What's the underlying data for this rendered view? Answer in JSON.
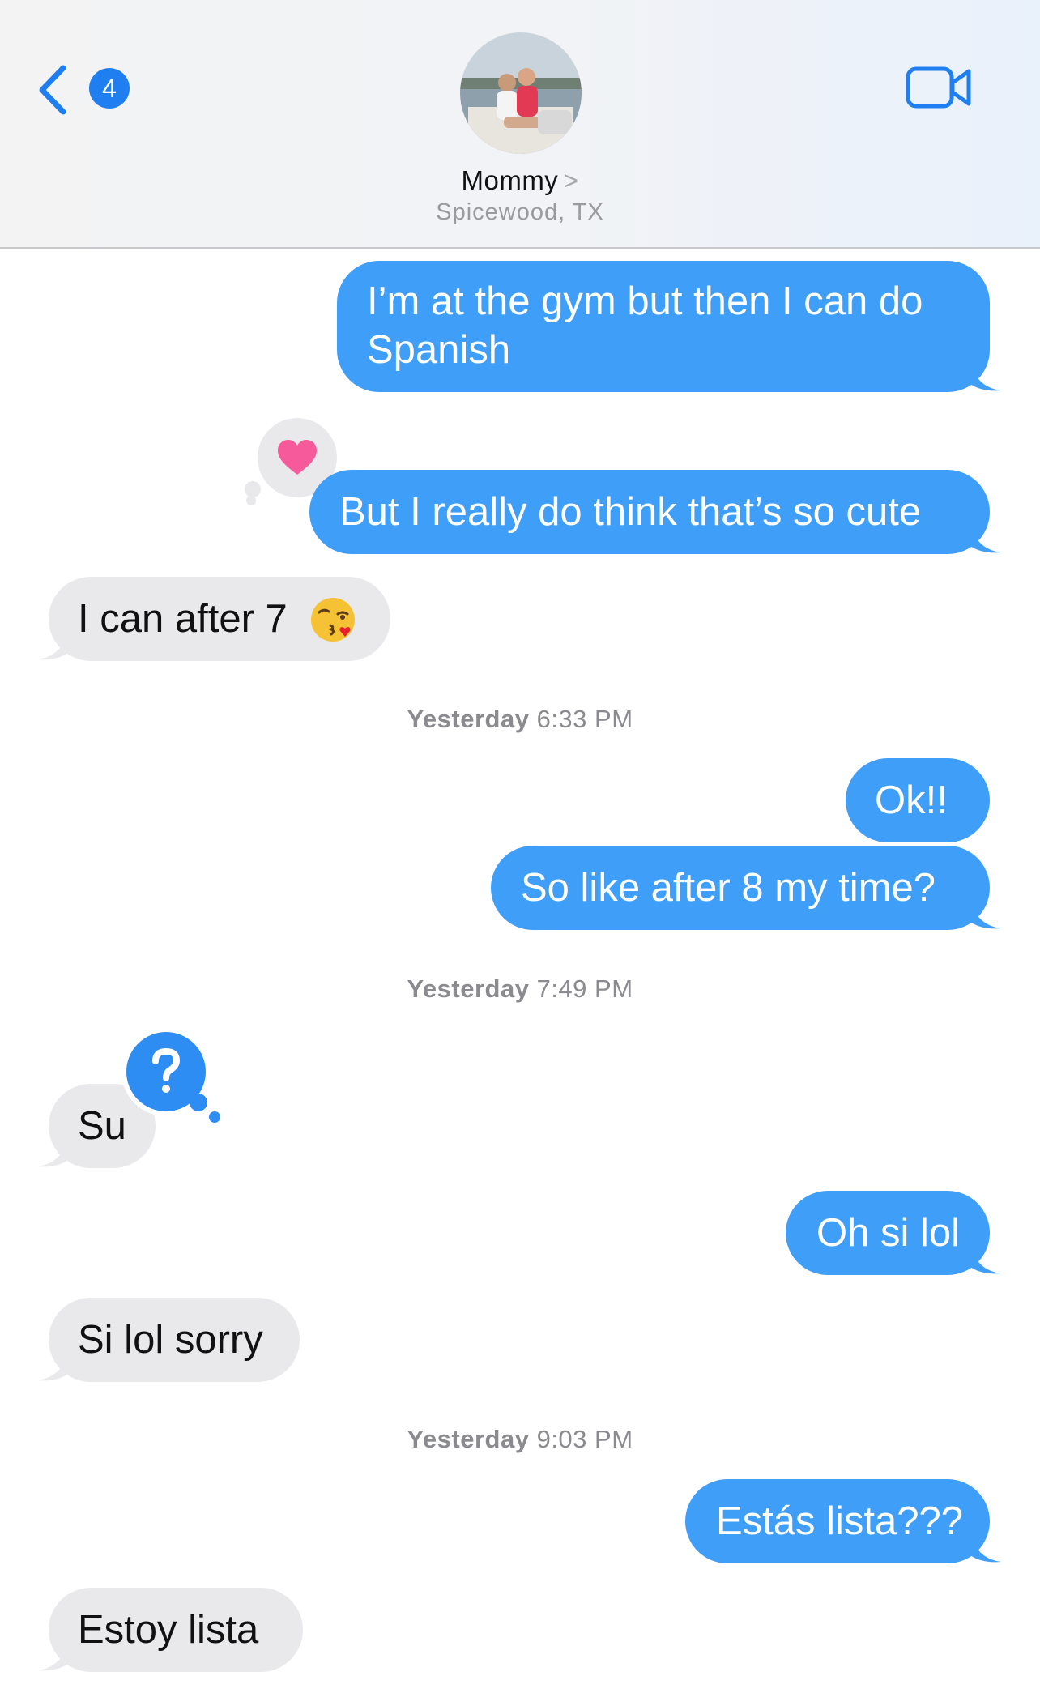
{
  "header": {
    "back_badge_count": "4",
    "contact_name": "Mommy",
    "contact_location": "Spicewood, TX",
    "chevron": ">"
  },
  "colors": {
    "accent": "#1f7ff0",
    "outgoing_bubble": "#3f9ff8",
    "incoming_bubble": "#e9e9eb",
    "heart": "#f75a9a"
  },
  "icons": {
    "back": "chevron-left-icon",
    "video": "video-camera-icon",
    "tapback_love": "heart-icon",
    "tapback_question": "question-mark-icon"
  },
  "messages": [
    {
      "from": "me",
      "text_line1": "I’m at the gym but then I can do",
      "text_line2": "Spanish"
    },
    {
      "from": "me",
      "text": "But I really do think that’s so cute",
      "tapback": "heart"
    },
    {
      "from": "them",
      "text": "I can after 7",
      "emoji": "😘"
    },
    {
      "type": "timestamp",
      "day": "Yesterday",
      "time": "6:33 PM"
    },
    {
      "from": "me",
      "text": "Ok!!"
    },
    {
      "from": "me",
      "text": "So like after 8 my time?"
    },
    {
      "type": "timestamp",
      "day": "Yesterday",
      "time": "7:49 PM"
    },
    {
      "from": "them",
      "text": "Su",
      "tapback": "question"
    },
    {
      "from": "me",
      "text": "Oh si lol"
    },
    {
      "from": "them",
      "text": "Si lol sorry"
    },
    {
      "type": "timestamp",
      "day": "Yesterday",
      "time": "9:03 PM"
    },
    {
      "from": "me",
      "text": "Estás lista???"
    },
    {
      "from": "them",
      "text": "Estoy lista"
    }
  ]
}
